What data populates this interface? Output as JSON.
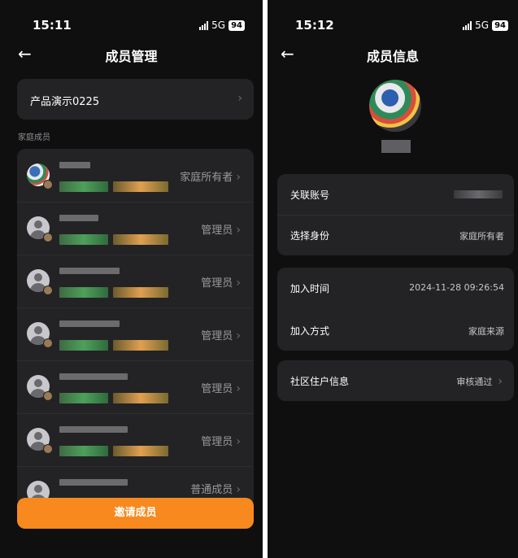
{
  "left": {
    "status": {
      "time": "15:11",
      "network": "5G",
      "battery": "94"
    },
    "title": "成员管理",
    "family": {
      "name": "产品演示0225"
    },
    "section_label": "家庭成员",
    "members": [
      {
        "role": "家庭所有者",
        "avatar": "photo"
      },
      {
        "role": "管理员",
        "avatar": "default"
      },
      {
        "role": "管理员",
        "avatar": "default"
      },
      {
        "role": "管理员",
        "avatar": "default"
      },
      {
        "role": "管理员",
        "avatar": "default"
      },
      {
        "role": "管理员",
        "avatar": "default"
      },
      {
        "role": "普通成员",
        "avatar": "default"
      }
    ],
    "invite_label": "邀请成员"
  },
  "right": {
    "status": {
      "time": "15:12",
      "network": "5G",
      "battery": "94"
    },
    "title": "成员信息",
    "rows": {
      "account": {
        "label": "关联账号"
      },
      "identity": {
        "label": "选择身份",
        "value": "家庭所有者"
      },
      "join_time": {
        "label": "加入时间",
        "value": "2024-11-28 09:26:54"
      },
      "join_method": {
        "label": "加入方式",
        "value": "家庭来源"
      },
      "community": {
        "label": "社区住户信息",
        "value": "审核通过"
      }
    }
  },
  "colors": {
    "background": "#0f0f10",
    "card": "#232326",
    "accent": "#f7891e",
    "muted": "#9a9a9e"
  }
}
